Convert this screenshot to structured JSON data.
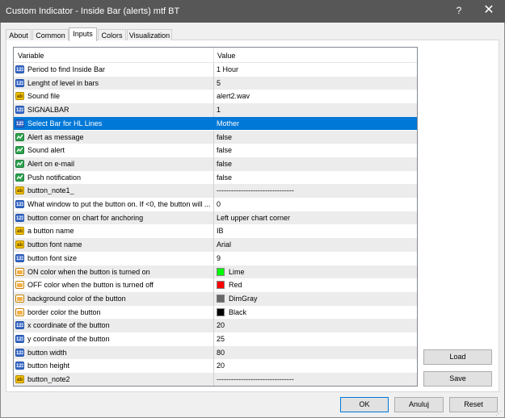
{
  "window": {
    "title": "Custom Indicator - Inside Bar (alerts) mtf BT",
    "help_label": "?",
    "close_label": "✕"
  },
  "tabs": [
    {
      "label": "About"
    },
    {
      "label": "Common"
    },
    {
      "label": "Inputs",
      "active": true
    },
    {
      "label": "Colors"
    },
    {
      "label": "Visualization"
    }
  ],
  "grid": {
    "columns": {
      "variable": "Variable",
      "value": "Value"
    },
    "rows": [
      {
        "type": "num",
        "name": "Period to find Inside Bar",
        "value": "1 Hour"
      },
      {
        "type": "num",
        "name": "Lenght of level in bars",
        "value": "5"
      },
      {
        "type": "str",
        "name": "Sound file",
        "value": "alert2.wav"
      },
      {
        "type": "num",
        "name": "SIGNALBAR",
        "value": "1"
      },
      {
        "type": "num",
        "name": "Select Bar for HL Lines",
        "value": "Mother",
        "selected": true
      },
      {
        "type": "bool",
        "name": "Alert as message",
        "value": "false"
      },
      {
        "type": "bool",
        "name": "Sound alert",
        "value": "false"
      },
      {
        "type": "bool",
        "name": "Alert on e-mail",
        "value": "false"
      },
      {
        "type": "bool",
        "name": "Push notification",
        "value": "false"
      },
      {
        "type": "str",
        "name": "button_note1_",
        "value": "--------------------------------"
      },
      {
        "type": "num",
        "name": "What window to put the button on.  If <0, the button will ...",
        "value": "0"
      },
      {
        "type": "num",
        "name": "button corner on chart for anchoring",
        "value": "Left upper chart corner"
      },
      {
        "type": "str",
        "name": "a button name",
        "value": "IB"
      },
      {
        "type": "str",
        "name": "button font name",
        "value": "Arial"
      },
      {
        "type": "num",
        "name": "button font size",
        "value": "9"
      },
      {
        "type": "col",
        "name": "ON color when the button is turned on",
        "value": "Lime",
        "swatch": "#00ff00"
      },
      {
        "type": "col",
        "name": "OFF color when the button is turned off",
        "value": "Red",
        "swatch": "#ff0000"
      },
      {
        "type": "col",
        "name": "background color of the button",
        "value": "DimGray",
        "swatch": "#696969"
      },
      {
        "type": "col",
        "name": "border color the button",
        "value": "Black",
        "swatch": "#000000"
      },
      {
        "type": "num",
        "name": "x coordinate of the button",
        "value": "20"
      },
      {
        "type": "num",
        "name": "y coordinate of the button",
        "value": "25"
      },
      {
        "type": "num",
        "name": "button width",
        "value": "80"
      },
      {
        "type": "num",
        "name": "button height",
        "value": "20"
      },
      {
        "type": "str",
        "name": "button_note2",
        "value": "--------------------------------"
      }
    ]
  },
  "icons": {
    "num": "123",
    "str": "ab",
    "bool": "",
    "col": ""
  },
  "side_buttons": {
    "load": "Load",
    "save": "Save"
  },
  "footer_buttons": {
    "ok": "OK",
    "cancel": "Anuluj",
    "reset": "Reset"
  },
  "colors": {
    "selection": "#0078d7",
    "titlebar": "#575757"
  }
}
